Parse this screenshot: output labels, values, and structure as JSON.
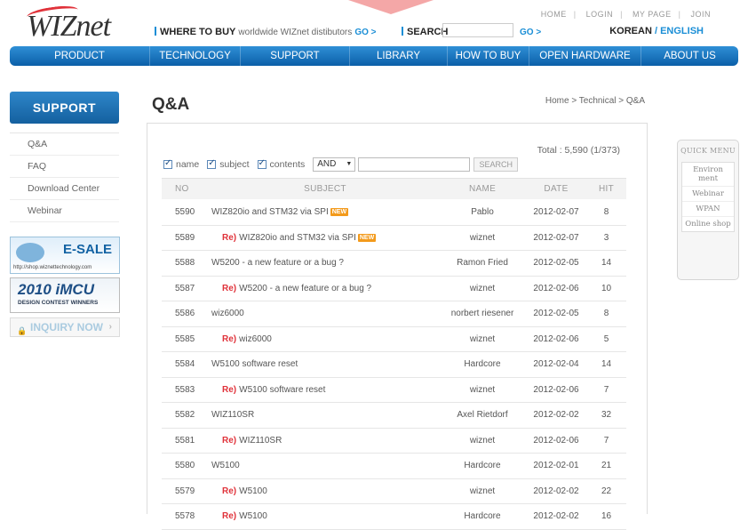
{
  "header": {
    "logo": "WIZnet",
    "util_links": [
      "HOME",
      "LOGIN",
      "MY PAGE",
      "JOIN"
    ],
    "where_to_buy_label": "WHERE TO BUY",
    "where_to_buy_text": "worldwide WIZnet distibutors",
    "go1": "GO >",
    "search_label": "SEARCH",
    "search_placeholder": "",
    "go2": "GO >",
    "lang_korean": "KOREAN",
    "lang_sep": "/",
    "lang_english": "ENGLISH"
  },
  "nav": [
    "PRODUCT",
    "TECHNOLOGY",
    "SUPPORT",
    "LIBRARY",
    "HOW TO BUY",
    "OPEN HARDWARE",
    "ABOUT US"
  ],
  "sidebar": {
    "title": "SUPPORT",
    "items": [
      "Q&A",
      "FAQ",
      "Download Center",
      "Webinar"
    ]
  },
  "banners": {
    "esale_title": "E-SALE",
    "esale_url": "http://shop.wiznettechnology.com",
    "imcu_title": "2010 iMCU",
    "imcu_sub": "DESIGN CONTEST WINNERS",
    "inquiry": "INQUIRY NOW"
  },
  "page": {
    "title": "Q&A",
    "breadcrumb": "Home > Technical > Q&A",
    "total": "Total : 5,590 (1/373)"
  },
  "filters": {
    "name": "name",
    "subject": "subject",
    "contents": "contents",
    "operator": "AND",
    "keyword": "",
    "search_button": "SEARCH"
  },
  "table": {
    "headers": [
      "NO",
      "SUBJECT",
      "NAME",
      "DATE",
      "HIT"
    ],
    "rows": [
      {
        "no": "5590",
        "reply": false,
        "subject": "WIZ820io and STM32 via SPI",
        "new": true,
        "name": "Pablo",
        "date": "2012-02-07",
        "hit": "8"
      },
      {
        "no": "5589",
        "reply": true,
        "subject": "WIZ820io and STM32 via SPI",
        "new": true,
        "name": "wiznet",
        "date": "2012-02-07",
        "hit": "3"
      },
      {
        "no": "5588",
        "reply": false,
        "subject": "W5200 - a new feature or a bug ?",
        "new": false,
        "name": "Ramon Fried",
        "date": "2012-02-05",
        "hit": "14"
      },
      {
        "no": "5587",
        "reply": true,
        "subject": "W5200 - a new feature or a bug ?",
        "new": false,
        "name": "wiznet",
        "date": "2012-02-06",
        "hit": "10"
      },
      {
        "no": "5586",
        "reply": false,
        "subject": "wiz6000",
        "new": false,
        "name": "norbert riesener",
        "date": "2012-02-05",
        "hit": "8"
      },
      {
        "no": "5585",
        "reply": true,
        "subject": "wiz6000",
        "new": false,
        "name": "wiznet",
        "date": "2012-02-06",
        "hit": "5"
      },
      {
        "no": "5584",
        "reply": false,
        "subject": "W5100 software reset",
        "new": false,
        "name": "Hardcore",
        "date": "2012-02-04",
        "hit": "14"
      },
      {
        "no": "5583",
        "reply": true,
        "subject": "W5100 software reset",
        "new": false,
        "name": "wiznet",
        "date": "2012-02-06",
        "hit": "7"
      },
      {
        "no": "5582",
        "reply": false,
        "subject": "WIZ110SR",
        "new": false,
        "name": "Axel Rietdorf",
        "date": "2012-02-02",
        "hit": "32"
      },
      {
        "no": "5581",
        "reply": true,
        "subject": "WIZ110SR",
        "new": false,
        "name": "wiznet",
        "date": "2012-02-06",
        "hit": "7"
      },
      {
        "no": "5580",
        "reply": false,
        "subject": "W5100",
        "new": false,
        "name": "Hardcore",
        "date": "2012-02-01",
        "hit": "21"
      },
      {
        "no": "5579",
        "reply": true,
        "subject": "W5100",
        "new": false,
        "name": "wiznet",
        "date": "2012-02-02",
        "hit": "22"
      },
      {
        "no": "5578",
        "reply": true,
        "subject": "W5100",
        "new": false,
        "name": "Hardcore",
        "date": "2012-02-02",
        "hit": "16"
      }
    ],
    "reply_label": "Re)",
    "new_label": "NEW"
  },
  "quick_menu": {
    "title": "QUICK MENU",
    "items": [
      "Environ ment",
      "Webinar",
      "WPAN",
      "Online shop"
    ]
  },
  "colors": {
    "accent": "#1a8ed6",
    "nav": "#0b5fa8",
    "reply": "#e0323a",
    "new_badge": "#f39a1b"
  }
}
